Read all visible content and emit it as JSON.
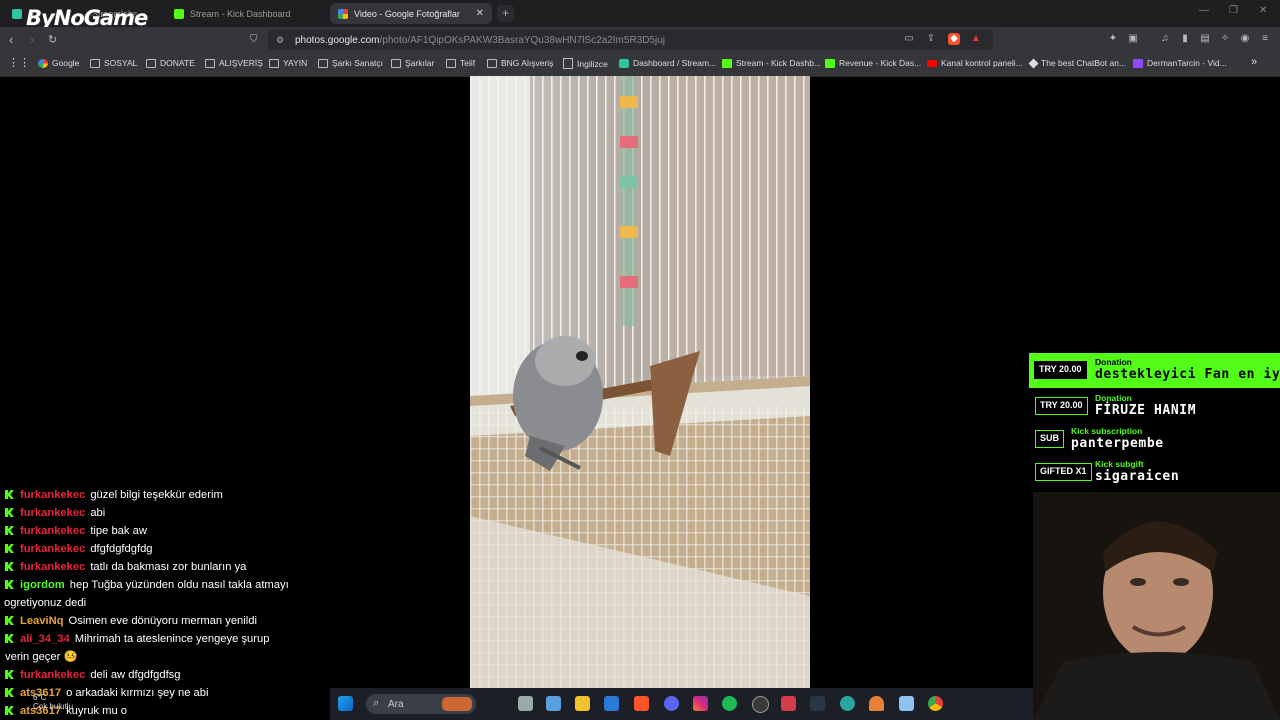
{
  "browser": {
    "tabs": [
      {
        "label": "Streamlabs",
        "color": "#31c3a2"
      },
      {
        "label": "Stream - Kick Dashboard",
        "color": "#53fc18"
      },
      {
        "label": "Video - Google Fotoğraflar",
        "color": "#4285f4"
      }
    ],
    "new_tab": "+",
    "window_controls": [
      "—",
      "❐",
      "✕"
    ],
    "url_host": "photos.google.com",
    "url_path": "/photo/AF1QipOKsPAKW3BasraYQu38wHN7lSc2a2Im5R3D5juj",
    "overlay_logo": "ByNoGame",
    "bookmarks": [
      {
        "label": "Google",
        "icon": "google-icon"
      },
      {
        "label": "SOSYAL",
        "icon": "folder-icon"
      },
      {
        "label": "DONATE",
        "icon": "folder-icon"
      },
      {
        "label": "ALIŞVERİŞ",
        "icon": "folder-icon"
      },
      {
        "label": "YAYIN",
        "icon": "folder-icon"
      },
      {
        "label": "Şarkı Sanatçı",
        "icon": "folder-icon"
      },
      {
        "label": "Şarkılar",
        "icon": "folder-icon"
      },
      {
        "label": "Telif",
        "icon": "folder-icon"
      },
      {
        "label": "BNG Alışveriş",
        "icon": "folder-icon"
      },
      {
        "label": "İngilizce",
        "icon": "page-icon"
      },
      {
        "label": "Dashboard / Stream...",
        "icon": "streamlabs-icon"
      },
      {
        "label": "Stream - Kick Dashb...",
        "icon": "kick-icon"
      },
      {
        "label": "Revenue - Kick Das...",
        "icon": "kick-icon"
      },
      {
        "label": "Kanal kontrol paneli...",
        "icon": "youtube-icon"
      },
      {
        "label": "The best ChatBot an...",
        "icon": "bot-icon"
      },
      {
        "label": "DermanTarcin - Vid...",
        "icon": "twitch-icon"
      }
    ],
    "more_bookmarks": "»"
  },
  "chat": [
    {
      "user": "furkankekec",
      "color": "red",
      "text": "güzel bilgi teşekkür ederim"
    },
    {
      "user": "furkankekec",
      "color": "red",
      "text": "abi"
    },
    {
      "user": "furkankekec",
      "color": "red",
      "text": "tipe bak aw"
    },
    {
      "user": "furkankekec",
      "color": "red",
      "text": "dfgfdgfdgfdg"
    },
    {
      "user": "furkankekec",
      "color": "red",
      "text": "tatlı da bakması zor bunların ya"
    },
    {
      "user": "igordom",
      "color": "green",
      "text": "hep Tuğba yüzünden oldu nasıl takla atmayı",
      "text2": "ogretiyonuz dedi"
    },
    {
      "user": "LeaviNq",
      "color": "yellow",
      "text": "Osimen eve dönüyoru merman yenildi"
    },
    {
      "user": "ali_34_34",
      "color": "red",
      "text": "Mihrimah ta ateslenince yengeye şurup",
      "text2": "verin geçer 🤒"
    },
    {
      "user": "furkankekec",
      "color": "red",
      "text": "deli aw dfgdfgdfsg"
    },
    {
      "user": "ats3617",
      "color": "yellow",
      "text": "o arkadaki kırmızı şey ne abi"
    },
    {
      "user": "ats3617",
      "color": "yellow",
      "text": "kuyruk mu o"
    }
  ],
  "alerts": [
    {
      "badge": "TRY 20.00",
      "kind": "Donation",
      "name": "destekleyici Fan en iyi f"
    },
    {
      "badge": "TRY 20.00",
      "kind": "Donation",
      "name": "FİRUZE HANIM"
    },
    {
      "badge": "SUB",
      "kind": "Kick subscription",
      "name": "panterpembe"
    },
    {
      "badge": "GIFTED X1",
      "kind": "Kick subgift",
      "name": "sigaraicen"
    }
  ],
  "taskbar": {
    "search_placeholder": "Ara",
    "weather_temp": "6°C",
    "weather_desc": "Çok bulutlu"
  },
  "colors": {
    "kick_green": "#53fc18",
    "chat_red": "#e8243b",
    "chat_yellow": "#e8a233"
  }
}
